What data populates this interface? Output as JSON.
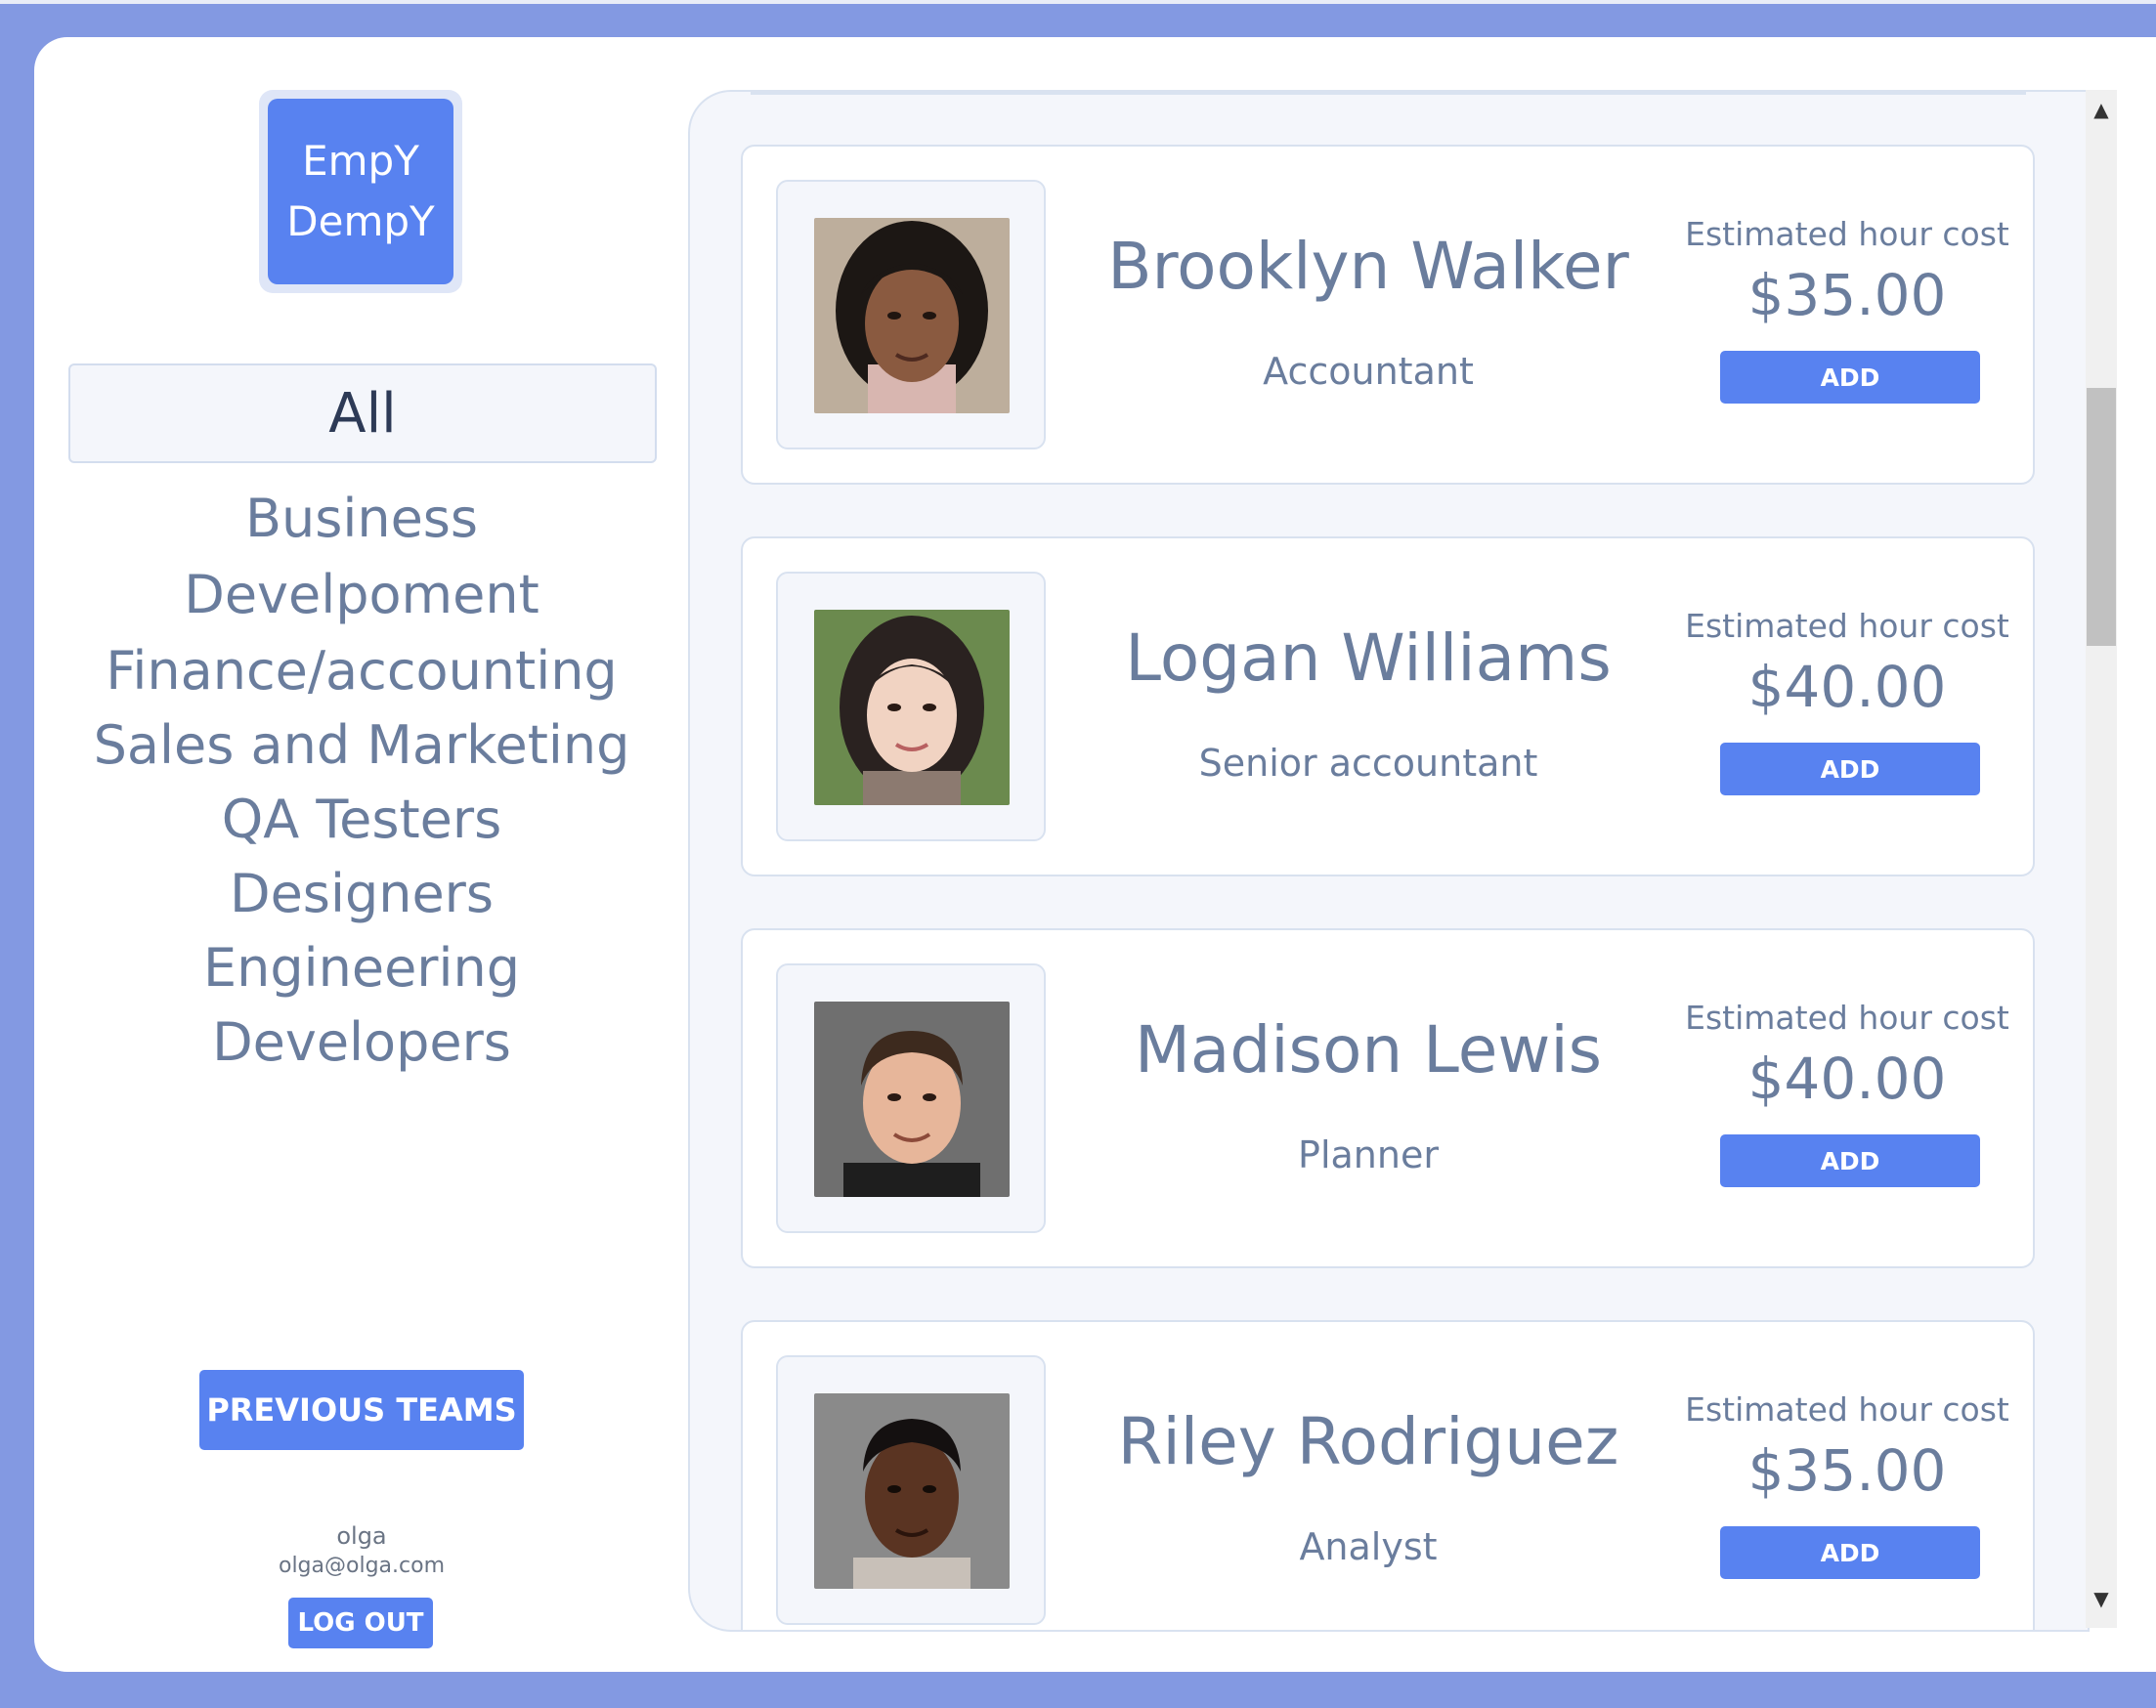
{
  "logo": {
    "line1": "EmpY",
    "line2": "DempY"
  },
  "categories": {
    "active": "All",
    "items": [
      "Business\nDevelpoment",
      "Finance/accounting",
      "Sales and Marketing",
      "QA Testers",
      "Designers",
      "Engineering",
      "Developers"
    ]
  },
  "sidebar": {
    "previous_teams_label": "PREVIOUS TEAMS",
    "user_name": "olga",
    "user_email": "olga@olga.com",
    "logout_label": "LOG OUT"
  },
  "employees": [
    {
      "name": "Brooklyn Walker",
      "role": "Accountant",
      "cost_label": "Estimated hour cost",
      "cost": "$35.00",
      "add_label": "ADD"
    },
    {
      "name": "Logan Williams",
      "role": "Senior accountant",
      "cost_label": "Estimated hour cost",
      "cost": "$40.00",
      "add_label": "ADD"
    },
    {
      "name": "Madison Lewis",
      "role": "Planner",
      "cost_label": "Estimated hour cost",
      "cost": "$40.00",
      "add_label": "ADD"
    },
    {
      "name": "Riley Rodriguez",
      "role": "Analyst",
      "cost_label": "Estimated hour cost",
      "cost": "$35.00",
      "add_label": "ADD"
    }
  ],
  "colors": {
    "background": "#8399e2",
    "accent": "#5882f0",
    "text_muted": "#6a7d9d",
    "panel": "#f4f6fb"
  }
}
